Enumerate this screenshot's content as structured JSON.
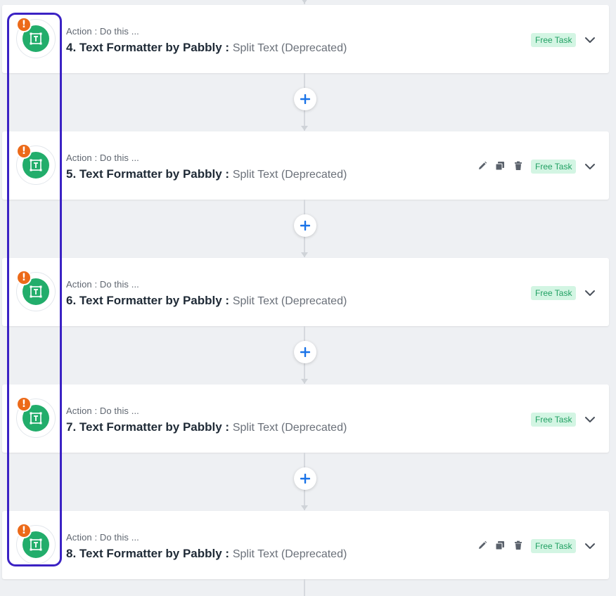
{
  "steps": [
    {
      "number": "4.",
      "action_label": "Action : Do this ...",
      "app_name": "Text Formatter by Pabbly :",
      "event_name": "Split Text (Deprecated)",
      "badge": "Free Task",
      "show_tools": false
    },
    {
      "number": "5.",
      "action_label": "Action : Do this ...",
      "app_name": "Text Formatter by Pabbly :",
      "event_name": "Split Text (Deprecated)",
      "badge": "Free Task",
      "show_tools": true
    },
    {
      "number": "6.",
      "action_label": "Action : Do this ...",
      "app_name": "Text Formatter by Pabbly :",
      "event_name": "Split Text (Deprecated)",
      "badge": "Free Task",
      "show_tools": false
    },
    {
      "number": "7.",
      "action_label": "Action : Do this ...",
      "app_name": "Text Formatter by Pabbly :",
      "event_name": "Split Text (Deprecated)",
      "badge": "Free Task",
      "show_tools": false
    },
    {
      "number": "8.",
      "action_label": "Action : Do this ...",
      "app_name": "Text Formatter by Pabbly :",
      "event_name": "Split Text (Deprecated)",
      "badge": "Free Task",
      "show_tools": true
    }
  ],
  "icons": {
    "app": "text-formatter-icon",
    "warning": "warning-icon",
    "warning_glyph": "!",
    "edit": "pencil-icon",
    "copy": "copy-icon",
    "delete": "trash-icon",
    "expand": "chevron-down-icon",
    "add": "plus-icon"
  },
  "colors": {
    "app_green": "#22ad6b",
    "warning_orange": "#ec6a19",
    "badge_bg": "#d3f5e3",
    "badge_text": "#21a063",
    "add_blue": "#1a73e8",
    "highlight": "#3b22c4"
  }
}
